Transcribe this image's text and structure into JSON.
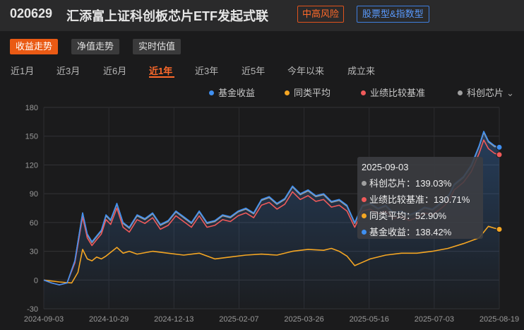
{
  "header": {
    "code": "020629",
    "name": "汇添富上证科创板芯片ETF发起式联",
    "risk": "中高风险",
    "type": "股票型&指数型"
  },
  "mode_tabs": [
    "收益走势",
    "净值走势",
    "实时估值"
  ],
  "range_tabs": [
    "近1月",
    "近3月",
    "近6月",
    "近1年",
    "近3年",
    "近5年",
    "今年以来",
    "成立来"
  ],
  "colors": {
    "fund": "#3f8ff0",
    "peer": "#f5a623",
    "benchmark": "#f05a5a",
    "index": "#a0a0a0",
    "accent": "#ff6a2b"
  },
  "tooltip": {
    "date": "2025-09-03",
    "rows": [
      {
        "label": "科创芯片：139.03%",
        "color": "#a0a0a0"
      },
      {
        "label": "业绩比较基准：130.71%",
        "color": "#f05a5a"
      },
      {
        "label": "同类平均：52.90%",
        "color": "#f5a623"
      },
      {
        "label": "基金收益：138.42%",
        "color": "#3f8ff0"
      }
    ]
  },
  "chart_data": {
    "type": "line",
    "ylim": [
      -30,
      180
    ],
    "yticks": [
      180,
      150,
      120,
      90,
      60,
      30,
      0,
      -30
    ],
    "xtick_labels": [
      "2024-09-03",
      "2024-10-29",
      "2024-12-13",
      "2025-02-07",
      "2025-03-26",
      "2025-05-16",
      "2025-07-03",
      "2025-08-19"
    ],
    "series": [
      {
        "name": "基金收益",
        "color": "#3f8ff0",
        "x": [
          0,
          5,
          10,
          15,
          20,
          25,
          28,
          31,
          34,
          37,
          40,
          43,
          47,
          51,
          55,
          60,
          65,
          70,
          75,
          80,
          85,
          90,
          95,
          100,
          105,
          110,
          115,
          120,
          125,
          130,
          135,
          140,
          145,
          150,
          155,
          160,
          165,
          170,
          175,
          180,
          185,
          190,
          195,
          200,
          205,
          210,
          215,
          220,
          225,
          230,
          235,
          240,
          245,
          250,
          255,
          258,
          261,
          264,
          270,
          275,
          280,
          283,
          286,
          290,
          293
        ],
        "y": [
          0,
          -3,
          -5,
          -3,
          20,
          70,
          48,
          40,
          46,
          52,
          68,
          63,
          80,
          60,
          55,
          68,
          64,
          70,
          58,
          62,
          72,
          66,
          60,
          72,
          60,
          62,
          68,
          66,
          72,
          75,
          70,
          84,
          87,
          80,
          85,
          98,
          90,
          94,
          88,
          90,
          82,
          84,
          78,
          60,
          78,
          80,
          75,
          78,
          70,
          72,
          68,
          71,
          76,
          74,
          80,
          84,
          90,
          100,
          108,
          120,
          140,
          155,
          145,
          140,
          138.42
        ]
      },
      {
        "name": "同类平均",
        "color": "#f5a623",
        "x": [
          0,
          10,
          18,
          22,
          25,
          28,
          31,
          34,
          37,
          40,
          47,
          51,
          55,
          60,
          70,
          80,
          90,
          100,
          110,
          120,
          130,
          140,
          150,
          160,
          170,
          180,
          185,
          190,
          195,
          200,
          210,
          220,
          230,
          240,
          250,
          260,
          270,
          280,
          286,
          290,
          293
        ],
        "y": [
          0,
          -2,
          -3,
          8,
          32,
          22,
          20,
          24,
          22,
          25,
          34,
          28,
          30,
          27,
          30,
          28,
          26,
          28,
          22,
          24,
          26,
          27,
          26,
          30,
          32,
          31,
          33,
          30,
          25,
          15,
          22,
          26,
          28,
          28,
          30,
          33,
          38,
          44,
          56,
          54,
          52.9
        ]
      },
      {
        "name": "业绩比较基准",
        "color": "#f05a5a",
        "x": [
          0,
          5,
          10,
          15,
          20,
          25,
          28,
          31,
          34,
          37,
          40,
          43,
          47,
          51,
          55,
          60,
          65,
          70,
          75,
          80,
          85,
          90,
          95,
          100,
          105,
          110,
          115,
          120,
          125,
          130,
          135,
          140,
          145,
          150,
          155,
          160,
          165,
          170,
          175,
          180,
          185,
          190,
          195,
          200,
          205,
          210,
          215,
          220,
          225,
          230,
          235,
          240,
          245,
          250,
          255,
          258,
          261,
          264,
          270,
          275,
          280,
          283,
          286,
          290,
          293
        ],
        "y": [
          0,
          -3,
          -5,
          -3,
          18,
          66,
          44,
          36,
          42,
          48,
          63,
          58,
          75,
          55,
          50,
          63,
          59,
          65,
          53,
          57,
          67,
          61,
          55,
          67,
          55,
          57,
          63,
          61,
          67,
          70,
          65,
          78,
          81,
          74,
          79,
          92,
          84,
          88,
          82,
          84,
          76,
          78,
          72,
          55,
          72,
          74,
          69,
          72,
          64,
          66,
          62,
          65,
          70,
          68,
          74,
          78,
          84,
          94,
          102,
          113,
          132,
          146,
          137,
          132,
          130.71
        ]
      },
      {
        "name": "科创芯片",
        "color": "#a0a0a0",
        "x": [
          0,
          5,
          10,
          15,
          20,
          25,
          28,
          31,
          34,
          37,
          40,
          43,
          47,
          51,
          55,
          60,
          65,
          70,
          75,
          80,
          85,
          90,
          95,
          100,
          105,
          110,
          115,
          120,
          125,
          130,
          135,
          140,
          145,
          150,
          155,
          160,
          165,
          170,
          175,
          180,
          185,
          190,
          195,
          200,
          205,
          210,
          215,
          220,
          225,
          230,
          235,
          240,
          245,
          250,
          255,
          258,
          261,
          264,
          270,
          275,
          280,
          283,
          286,
          290,
          293
        ],
        "y": [
          0,
          -3,
          -5,
          -3,
          20,
          70,
          47,
          39,
          45,
          51,
          67,
          62,
          79,
          59,
          54,
          67,
          63,
          69,
          57,
          61,
          71,
          65,
          59,
          71,
          59,
          61,
          67,
          65,
          71,
          74,
          69,
          83,
          86,
          79,
          84,
          97,
          89,
          93,
          87,
          89,
          81,
          83,
          77,
          59,
          77,
          79,
          74,
          77,
          69,
          71,
          67,
          70,
          75,
          73,
          79,
          83,
          89,
          99,
          107,
          119,
          139,
          154,
          144,
          139,
          139.03
        ]
      }
    ]
  }
}
